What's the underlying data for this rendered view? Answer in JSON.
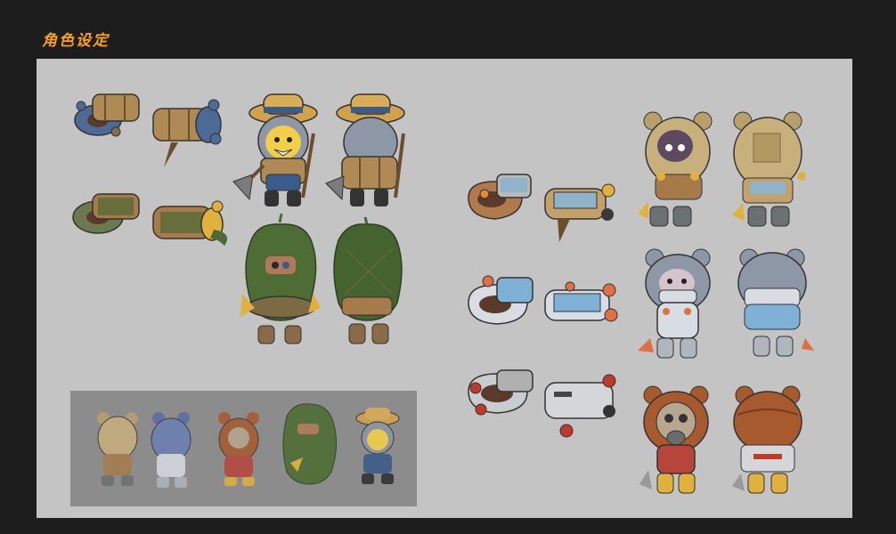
{
  "header": {
    "title": "角色设定"
  },
  "colors": {
    "background": "#1d1d1d",
    "title": "#f7a01d",
    "sheet": "#c4c4c4",
    "lineup_panel": "#8c8c8c"
  },
  "characters": [
    {
      "theme": "straw-hat-miner",
      "views": [
        "backpack-front",
        "backpack-side",
        "front",
        "back"
      ]
    },
    {
      "theme": "leaf-ghillie",
      "views": [
        "backpack-front",
        "backpack-side",
        "front",
        "back"
      ]
    },
    {
      "theme": "sand-bear-diver",
      "views": [
        "backpack-front",
        "backpack-side",
        "front",
        "back"
      ]
    },
    {
      "theme": "ice-bear-diver",
      "views": [
        "backpack-front",
        "backpack-side",
        "front",
        "back"
      ]
    },
    {
      "theme": "rust-bear-gasmask",
      "views": [
        "backpack-front",
        "backpack-side",
        "front",
        "back"
      ]
    }
  ]
}
